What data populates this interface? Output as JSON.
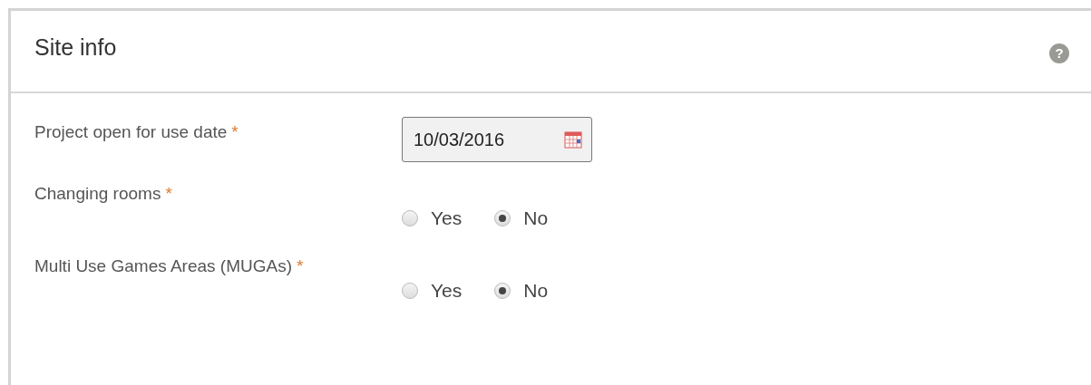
{
  "panel": {
    "title": "Site info",
    "help": "?"
  },
  "fields": [
    {
      "kind": "date",
      "label": "Project open for use date",
      "required_mark": "*",
      "value": "10/03/2016"
    },
    {
      "kind": "radio",
      "label": "Changing rooms",
      "required_mark": "*",
      "options": [
        {
          "label": "Yes",
          "selected": false
        },
        {
          "label": "No",
          "selected": true
        }
      ]
    },
    {
      "kind": "radio",
      "label": "Multi Use Games Areas (MUGAs)",
      "required_mark": "*",
      "options": [
        {
          "label": "Yes",
          "selected": false
        },
        {
          "label": "No",
          "selected": true
        }
      ]
    }
  ]
}
